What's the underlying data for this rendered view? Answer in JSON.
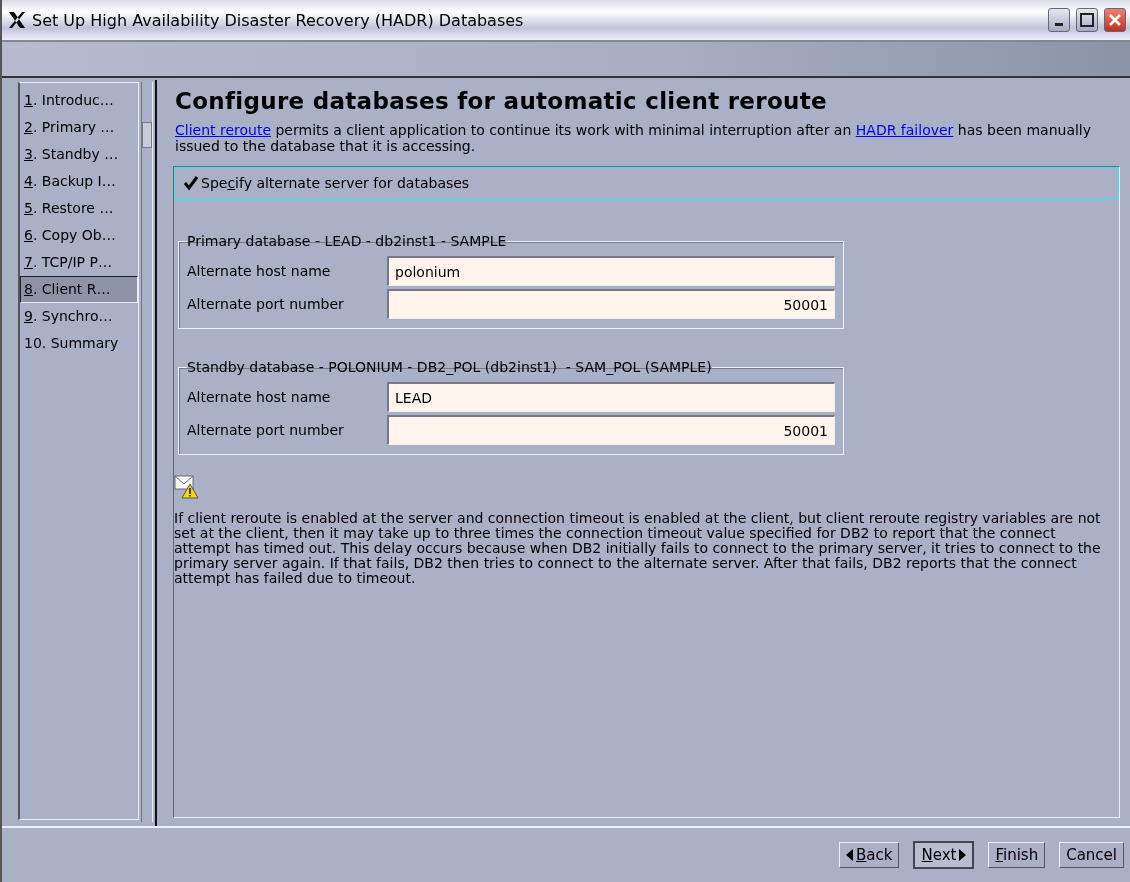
{
  "window": {
    "title": "Set Up High Availability Disaster Recovery (HADR) Databases"
  },
  "steps": [
    {
      "key": "1",
      "rest": ". Introduc…",
      "selected": false
    },
    {
      "key": "2",
      "rest": ". Primary …",
      "selected": false
    },
    {
      "key": "3",
      "rest": ". Standby …",
      "selected": false
    },
    {
      "key": "4",
      "rest": ". Backup I…",
      "selected": false
    },
    {
      "key": "5",
      "rest": ". Restore …",
      "selected": false
    },
    {
      "key": "6",
      "rest": ". Copy Ob…",
      "selected": false
    },
    {
      "key": "7",
      "rest": ". TCP/IP P…",
      "selected": false
    },
    {
      "key": "8",
      "rest": ". Client R…",
      "selected": true
    },
    {
      "key": "9",
      "rest": ". Synchro…",
      "selected": false
    },
    {
      "rest": "10. Summary",
      "selected": false
    }
  ],
  "page": {
    "heading": "Configure databases for automatic client reroute",
    "intro": [
      {
        "kind": "link",
        "text": "Client reroute"
      },
      {
        "kind": "text",
        "text": " permits a client application to continue its work with minimal interruption after an "
      },
      {
        "kind": "link",
        "text": "HADR failover"
      },
      {
        "kind": "text",
        "text": " has been manually issued to the database that it is accessing."
      }
    ],
    "alternate_checkbox": {
      "pre": "Spe",
      "key": "c",
      "rest": "ify alternate server for databases",
      "checked": true
    },
    "groups": [
      {
        "title": "Primary database - LEAD - db2inst1 - SAMPLE",
        "fields": [
          {
            "label": "Alternate host name",
            "value": "polonium",
            "kind": "text"
          },
          {
            "label": "Alternate port number",
            "value": "50001",
            "kind": "number"
          }
        ]
      },
      {
        "title": "Standby database - POLONIUM - DB2_POL (db2inst1)  - SAM_POL (SAMPLE)",
        "fields": [
          {
            "label": "Alternate host name",
            "value": "LEAD",
            "kind": "text"
          },
          {
            "label": "Alternate port number",
            "value": "50001",
            "kind": "number"
          }
        ]
      }
    ],
    "note": "If client reroute is enabled at the server and connection timeout is enabled at the client, but client reroute registry variables are not set at the client, then it may take up to three times the connection timeout value specified for DB2 to report that the connect attempt has timed out. This delay occurs because when DB2 initially fails to connect to the primary server, it tries to connect to the primary server again. If that fails, DB2 then tries to connect to the alternate server. After that fails, DB2 reports that the connect attempt has failed due to timeout."
  },
  "buttons": [
    {
      "kind": "back",
      "key": "B",
      "rest": "ack",
      "default": false
    },
    {
      "kind": "next",
      "key": "N",
      "rest": "ext",
      "default": true
    },
    {
      "kind": "plain",
      "key": "F",
      "rest": "inish",
      "default": false
    },
    {
      "kind": "plain",
      "rest": "Cancel",
      "default": false
    }
  ]
}
